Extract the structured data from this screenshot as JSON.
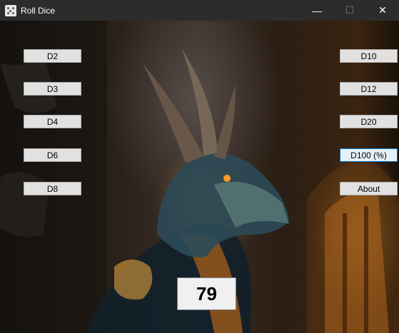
{
  "window": {
    "title": "Roll Dice",
    "controls": {
      "minimize": "—",
      "maximize": "☐",
      "close": "✕"
    }
  },
  "buttons_left": [
    {
      "label": "D2"
    },
    {
      "label": "D3"
    },
    {
      "label": "D4"
    },
    {
      "label": "D6"
    },
    {
      "label": "D8"
    }
  ],
  "buttons_right": [
    {
      "label": "D10"
    },
    {
      "label": "D12"
    },
    {
      "label": "D20"
    },
    {
      "label": "D100 (%)"
    },
    {
      "label": "About"
    }
  ],
  "result": {
    "value": "79"
  },
  "background": {
    "subject": "dragon-illustration"
  },
  "colors": {
    "titlebar": "#2c2c2c",
    "button_face": "#e1e1e1",
    "focused_border": "#0078d7",
    "result_background": "#f0f0f0"
  }
}
